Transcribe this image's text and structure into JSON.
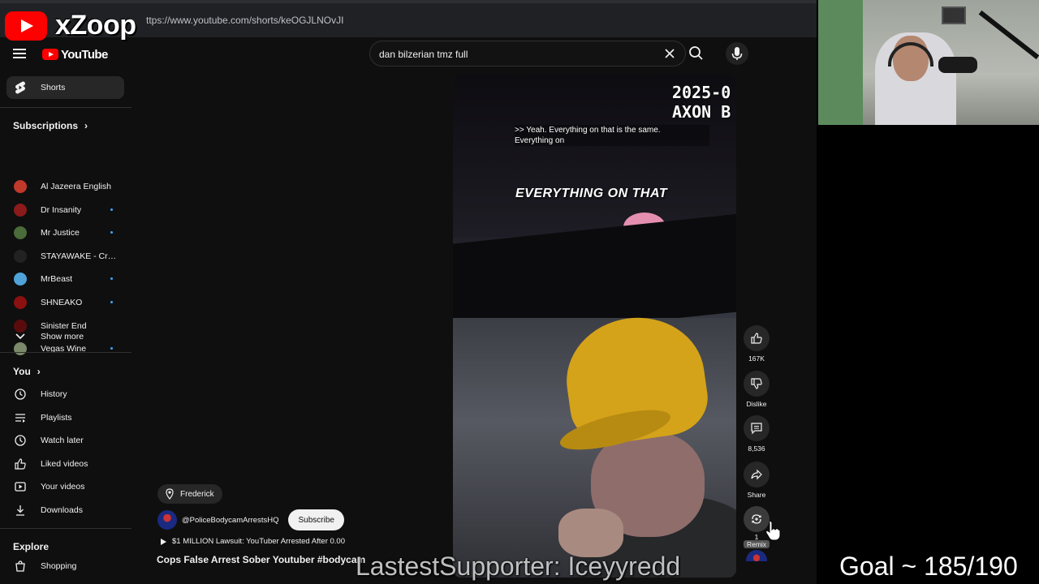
{
  "overlay": {
    "brand": "xZoop",
    "latest_supporter": "LastestSupporter: Iceyyredd",
    "goal": "Goal ~ 185/190"
  },
  "browser": {
    "url": "ttps://www.youtube.com/shorts/keOGJLNOvJI"
  },
  "youtube": {
    "logo_text": "YouTube",
    "search": {
      "value": "dan bilzerian tmz full",
      "placeholder": "Search"
    },
    "sidebar": {
      "shorts": "Shorts",
      "subscriptions_heading": "Subscriptions",
      "subscriptions": [
        {
          "name": "Al Jazeera English",
          "color": "#c0392b",
          "new": false
        },
        {
          "name": "Dr Insanity",
          "color": "#8b1a1a",
          "new": true
        },
        {
          "name": "Mr Justice",
          "color": "#4a6b3a",
          "new": true
        },
        {
          "name": "STAYAWAKE - Crim...",
          "color": "#222222",
          "new": false
        },
        {
          "name": "MrBeast",
          "color": "#4fa3d9",
          "new": true
        },
        {
          "name": "SHNEAKO",
          "color": "#8b1010",
          "new": true
        },
        {
          "name": "Sinister End",
          "color": "#5a0c0c",
          "new": false
        },
        {
          "name": "Vegas Wine",
          "color": "#7a8a6a",
          "new": true
        }
      ],
      "show_more": "Show more",
      "you_heading": "You",
      "you_items": [
        {
          "label": "History",
          "icon": "history-icon"
        },
        {
          "label": "Playlists",
          "icon": "playlists-icon"
        },
        {
          "label": "Watch later",
          "icon": "watch-later-icon"
        },
        {
          "label": "Liked videos",
          "icon": "like-icon"
        },
        {
          "label": "Your videos",
          "icon": "your-videos-icon"
        },
        {
          "label": "Downloads",
          "icon": "download-icon"
        }
      ],
      "explore_heading": "Explore",
      "explore_items": [
        {
          "label": "Shopping",
          "icon": "shopping-icon"
        }
      ]
    },
    "short": {
      "timestamp": "2025-0\nAXON B",
      "caption": ">> Yeah. Everything on that is the same.\nEverything on",
      "big_caption": "EVERYTHING ON THAT",
      "actions": {
        "like_count": "167K",
        "dislike_label": "Dislike",
        "comment_count": "8,536",
        "share_label": "Share",
        "remix_count": "1",
        "remix_label": "Remix"
      },
      "location": "Frederick",
      "channel_handle": "@PoliceBodycamArrestsHQ",
      "subscribe_label": "Subscribe",
      "related": "$1 MILLION Lawsuit: YouTuber Arrested After 0.00",
      "title": "Cops False Arrest Sober Youtuber #bodycam"
    }
  }
}
